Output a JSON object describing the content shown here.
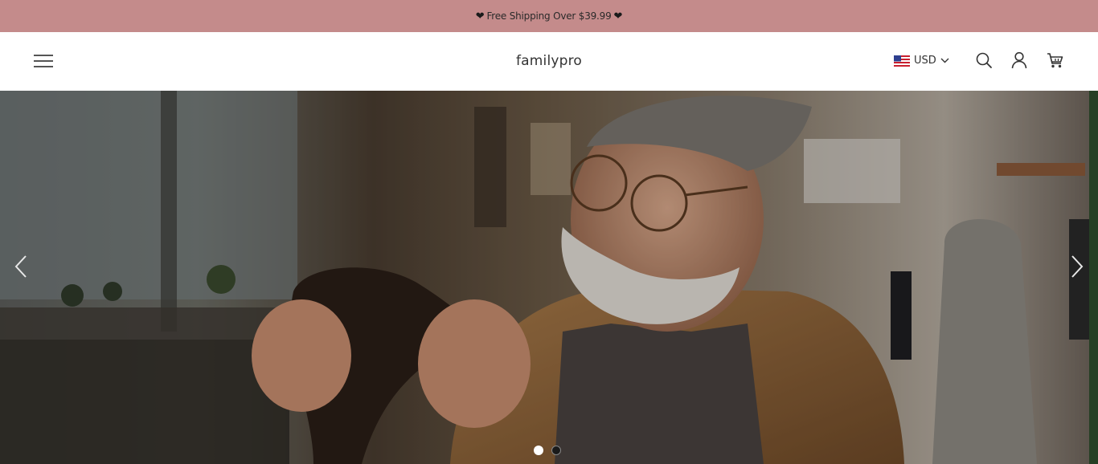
{
  "announcement": {
    "text": "Free Shipping Over $39.99",
    "icon": "heart-icon"
  },
  "header": {
    "menu_icon": "hamburger-menu-icon",
    "brand": "familypro",
    "currency": {
      "code": "USD",
      "flag": "us-flag-icon"
    },
    "icons": [
      "search-icon",
      "account-icon",
      "cart-icon"
    ]
  },
  "hero": {
    "image": "craftsman-inspecting-leather-photo",
    "prev_icon": "chevron-left-icon",
    "next_icon": "chevron-right-icon",
    "slide_count": 2,
    "active_slide": 1
  },
  "colors": {
    "announcement_bg": "#c48b8b",
    "header_bg": "#ffffff",
    "text": "#333333"
  }
}
